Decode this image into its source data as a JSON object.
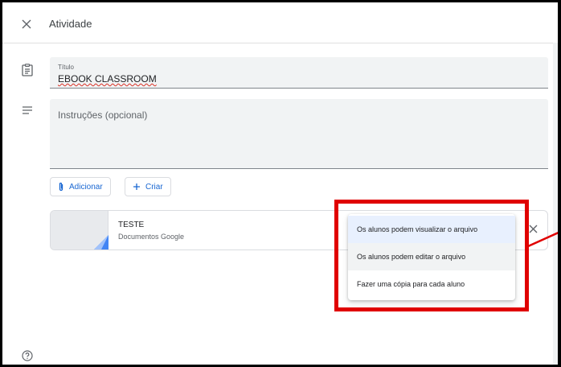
{
  "header": {
    "title": "Atividade"
  },
  "form": {
    "title_label": "Título",
    "title_value": "EBOOK CLASSROOM",
    "instructions_placeholder": "Instruções (opcional)"
  },
  "actions": {
    "add_label": "Adicionar",
    "create_label": "Criar"
  },
  "attachment": {
    "name": "TESTE",
    "type": "Documentos Google"
  },
  "share_menu": {
    "options": [
      "Os alunos podem visualizar o arquivo",
      "Os alunos podem editar o arquivo",
      "Fazer uma cópia para cada aluno"
    ],
    "selected_index": 0
  },
  "icons": {
    "close": "close-icon",
    "assignment": "assignment-icon",
    "notes": "notes-icon",
    "attach": "paperclip-icon",
    "plus": "plus-icon",
    "help": "help-icon"
  },
  "colors": {
    "accent": "#1967d2",
    "highlight": "#e00000",
    "selected_bg": "#e8f0fe"
  }
}
